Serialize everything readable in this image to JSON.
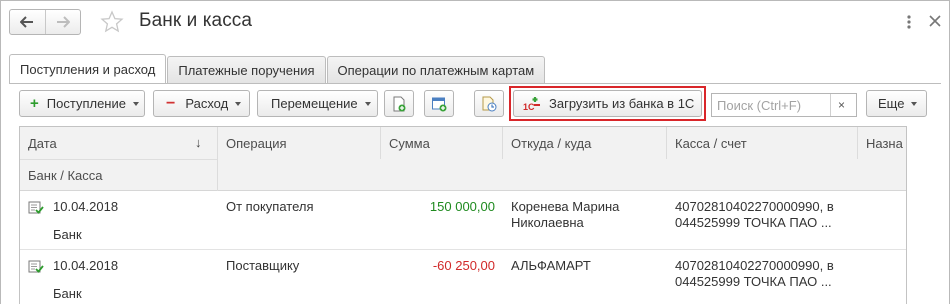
{
  "window": {
    "title": "Банк и касса"
  },
  "tabs": [
    {
      "label": "Поступления и расход",
      "active": true
    },
    {
      "label": "Платежные поручения",
      "active": false
    },
    {
      "label": "Операции по платежным картам",
      "active": false
    }
  ],
  "toolbar": {
    "receipt_label": "Поступление",
    "expense_label": "Расход",
    "transfer_label": "Перемещение",
    "load_bank_label": "Загрузить из банка в 1С",
    "search_placeholder": "Поиск (Ctrl+F)",
    "search_clear": "×",
    "more_label": "Еще"
  },
  "table": {
    "columns": {
      "date": "Дата",
      "sort_indicator": "↓",
      "bank_cash": "Банк / Касса",
      "operation": "Операция",
      "amount": "Сумма",
      "counterparty": "Откуда / куда",
      "account": "Касса / счет",
      "purpose": "Назна"
    },
    "rows": [
      {
        "date": "10.04.2018",
        "bank_cash": "Банк",
        "operation": "От покупателя",
        "amount": "150 000,00",
        "amount_sign": "positive",
        "counterparty_line1": "Коренева Марина",
        "counterparty_line2": "Николаевна",
        "account_line1": "40702810402270000990, в",
        "account_line2": "044525999 ТОЧКА ПАО ..."
      },
      {
        "date": "10.04.2018",
        "bank_cash": "Банк",
        "operation": "Поставщику",
        "amount": "-60 250,00",
        "amount_sign": "negative",
        "counterparty_line1": "АЛЬФАМАРТ",
        "counterparty_line2": "",
        "account_line1": "40702810402270000990, в",
        "account_line2": "044525999 ТОЧКА ПАО ..."
      }
    ]
  },
  "colors": {
    "accent_green": "#2d9c2d",
    "accent_red": "#d13232",
    "highlight_red": "#d9262a",
    "positive_amount": "#1f8a1f",
    "negative_amount": "#d12a2a"
  }
}
